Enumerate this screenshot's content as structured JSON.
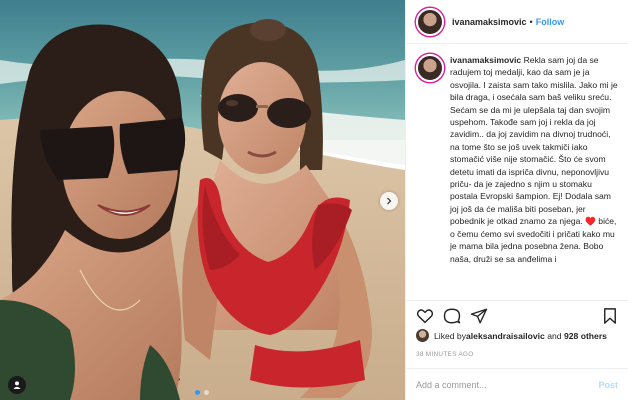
{
  "post": {
    "username": "ivanamaksimovic",
    "separator": "•",
    "follow_label": "Follow",
    "caption_username": "ivanamaksimovic",
    "caption_body": "Rekla sam joj da se radujem toj medalji, kao da sam je ja osvojila. I zaista sam tako mislila. Jako mi je bila draga, i osećala sam baš veliku sreću. Sećam se da mi je ulepšala taj dan svojim uspehom. Takođe sam joj i rekla da joj zavidim.. da joj zavidim na divnoj trudnoći, na tome što se još uvek takmiči iako stomačić više nije stomačić. Što će svom detetu imati da ispriča divnu, neponovljivu priču- da je zajedno s njim u stomaku postala Evropski šampion. Ej! Dodala sam joj još da će mališa biti poseban, jer pobednik je otkad znamo za njega. ♥️ biće, o čemu ćemo svi svedočiti i pričati kako mu je mama bila jedna posebna žena. Bobo naša, druži se sa anđelima i",
    "likes_prefix": "Liked by ",
    "liked_by_user": "aleksandraisailovic",
    "likes_and": " and ",
    "others_count": "928 others",
    "timestamp": "38 MINUTES AGO",
    "comment_placeholder": "Add a comment...",
    "post_label": "Post"
  },
  "icons": {
    "like": "heart-icon",
    "comment": "comment-icon",
    "share": "share-icon",
    "save": "bookmark-icon",
    "next": "chevron-right-icon",
    "tag": "user-tag-icon"
  },
  "colors": {
    "link": "#3897f0",
    "text": "#262626",
    "muted": "#999999",
    "post_disabled": "#b2dffc",
    "swimsuit": "#c8262c"
  },
  "carousel": {
    "current": 1,
    "total": 2
  }
}
